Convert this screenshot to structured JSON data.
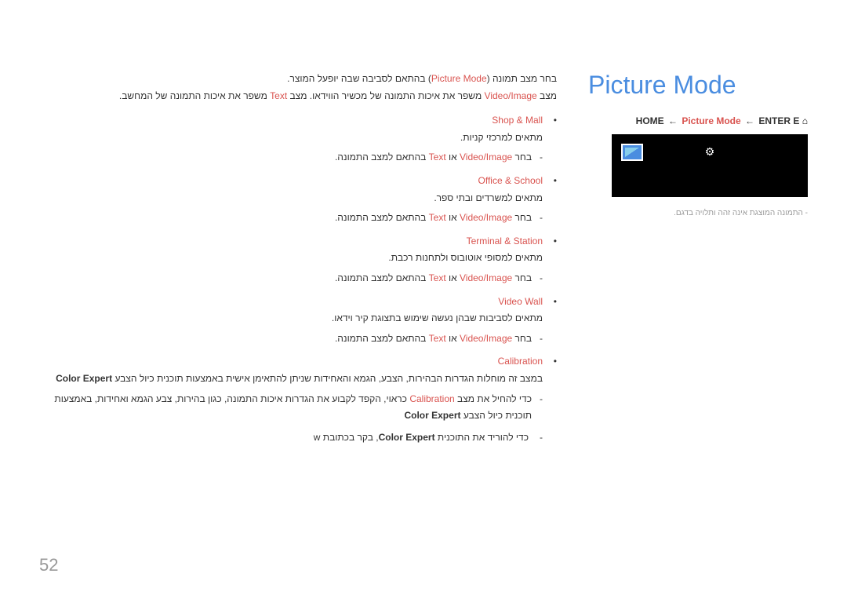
{
  "title": "Picture Mode",
  "breadcrumb": {
    "home_icon": "⌂",
    "home": "HOME",
    "arrow": "←",
    "picture_mode": "Picture Mode",
    "enter": "ENTER E"
  },
  "note": "התמונה המוצגת אינה זהה ותלויה בדגם.",
  "intro": {
    "line1_pre": "בחר מצב תמונה (",
    "line1_pm": "Picture Mode",
    "line1_post": ") בהתאם לסביבה שבה יופעל המוצר.",
    "line2_pre": "מצב ",
    "line2_vi": "Video/Image",
    "line2_mid": " משפר את איכות התמונה של מכשיר הווידאו. מצב ",
    "line2_text": "Text",
    "line2_post": " משפר את איכות התמונה של המחשב."
  },
  "modes": [
    {
      "name": "Shop & Mall",
      "desc": "מתאים למרכזי קניות.",
      "sub_pre": "בחר ",
      "sub_vi": "Video/Image",
      "sub_or": " או ",
      "sub_text": "Text",
      "sub_post": " בהתאם למצב התמונה."
    },
    {
      "name": "Office & School",
      "desc": "מתאים למשרדים ובתי ספר.",
      "sub_pre": "בחר ",
      "sub_vi": "Video/Image",
      "sub_or": " או ",
      "sub_text": "Text",
      "sub_post": " בהתאם למצב התמונה."
    },
    {
      "name": "Terminal & Station",
      "desc": "מתאים למסופי אוטובוס ולתחנות רכבת.",
      "sub_pre": "בחר ",
      "sub_vi": "Video/Image",
      "sub_or": " או ",
      "sub_text": "Text",
      "sub_post": " בהתאם למצב התמונה."
    },
    {
      "name": "Video Wall",
      "desc": "מתאים לסביבות שבהן נעשה שימוש בתצוגת קיר וידאו.",
      "sub_pre": "בחר ",
      "sub_vi": "Video/Image",
      "sub_or": " או ",
      "sub_text": "Text",
      "sub_post": " בהתאם למצב התמונה."
    }
  ],
  "calibration": {
    "title": "Calibration",
    "line1": "במצב זה מוחלות הגדרות הבהירות, הצבע, הגמא והאחידות שניתן להתאימן אישית באמצעות תוכנית כיול הצבע",
    "line1_ce": "Color Expert",
    "line2_pre": "כדי להחיל את מצב ",
    "line2_cal": "Calibration",
    "line2_post": " כראוי, הקפד לקבוע את הגדרות איכות התמונה, כגון בהירות, צבע הגמא ואחידות, באמצעות",
    "line2_end": "תוכנית כיול הצבע ",
    "line2_ce": "Color Expert",
    "dl_pre": "כדי להוריד את התוכנית ",
    "dl_ce": "Color Expert",
    "dl_post": ", בקר בכתובת  ",
    "dl_url": "w"
  },
  "page_number": "52",
  "hyphen": "-"
}
